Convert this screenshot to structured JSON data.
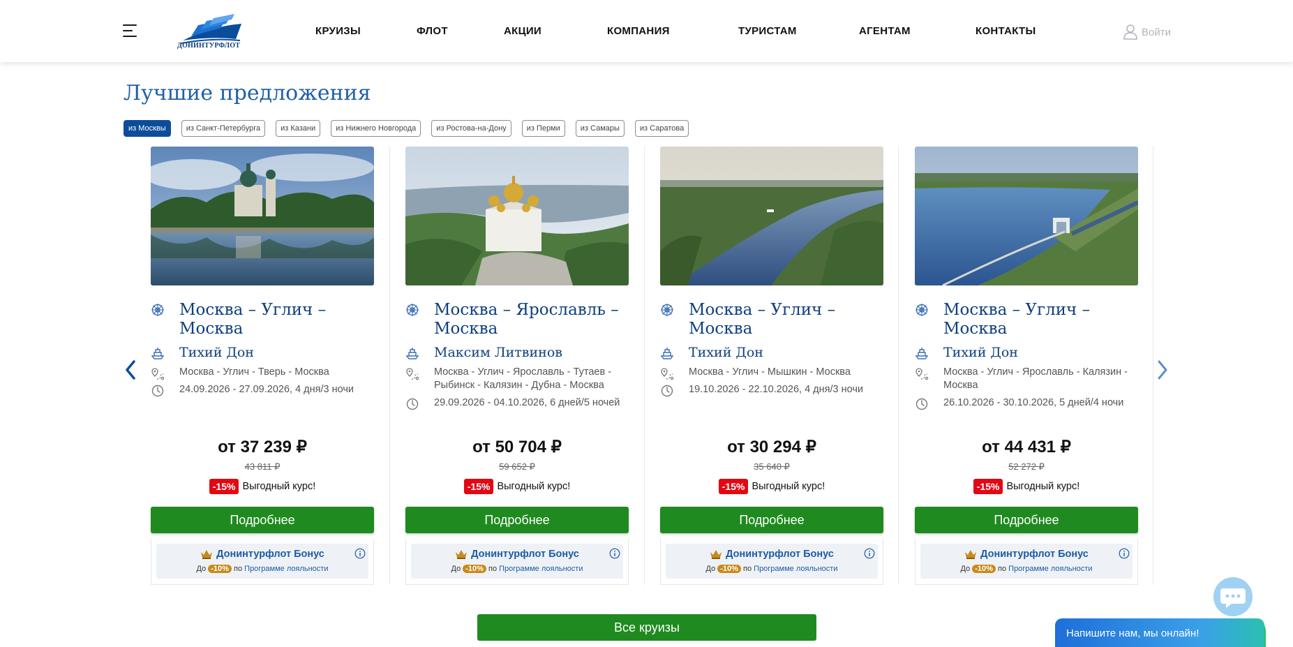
{
  "header": {
    "logo_text": "ДОНИНТУРФЛОТ",
    "nav": [
      "КРУИЗЫ",
      "ФЛОТ",
      "АКЦИИ",
      "КОМПАНИЯ",
      "ТУРИСТАМ",
      "АГЕНТАМ",
      "КОНТАКТЫ"
    ],
    "login_label": "Войти"
  },
  "section_title": "Лучшие предложения",
  "tabs": [
    "из Москвы",
    "из Санкт-Петербурга",
    "из Казани",
    "из Нижнего Новгорода",
    "из Ростова-на-Дону",
    "из Перми",
    "из Самары",
    "из Саратова"
  ],
  "active_tab": "из Москвы",
  "cards": [
    {
      "route": "Москва – Углич – Москва",
      "ship": "Тихий Дон",
      "stops": "Москва - Углич - Тверь - Москва",
      "dates": "24.09.2026 - 27.09.2026, 4 дня/3 ночи",
      "price": "от 37 239 ₽",
      "old_price": "43 811 ₽",
      "discount": "-15%",
      "promo": "Выгодный курс!",
      "button": "Подробнее",
      "bonus_title": "Донинтурфлот Бонус",
      "bonus_prefix": "До",
      "bonus_pct": "-10%",
      "bonus_mid": "по",
      "bonus_link": "Программе лояльности"
    },
    {
      "route": "Москва – Ярославль – Москва",
      "ship": "Максим Литвинов",
      "stops": "Москва - Углич - Ярославль - Тутаев - Рыбинск - Калязин - Дубна - Москва",
      "dates": "29.09.2026 - 04.10.2026, 6 дней/5 ночей",
      "price": "от 50 704 ₽",
      "old_price": "59 652 ₽",
      "discount": "-15%",
      "promo": "Выгодный курс!",
      "button": "Подробнее",
      "bonus_title": "Донинтурфлот Бонус",
      "bonus_prefix": "До",
      "bonus_pct": "-10%",
      "bonus_mid": "по",
      "bonus_link": "Программе лояльности"
    },
    {
      "route": "Москва – Углич – Москва",
      "ship": "Тихий Дон",
      "stops": "Москва - Углич - Мышкин - Москва",
      "dates": "19.10.2026 - 22.10.2026, 4 дня/3 ночи",
      "price": "от 30 294 ₽",
      "old_price": "35 640 ₽",
      "discount": "-15%",
      "promo": "Выгодный курс!",
      "button": "Подробнее",
      "bonus_title": "Донинтурфлот Бонус",
      "bonus_prefix": "До",
      "bonus_pct": "-10%",
      "bonus_mid": "по",
      "bonus_link": "Программе лояльности"
    },
    {
      "route": "Москва – Углич – Москва",
      "ship": "Тихий Дон",
      "stops": "Москва - Углич - Ярославль - Калязин - Москва",
      "dates": "26.10.2026 - 30.10.2026, 5 дней/4 ночи",
      "price": "от 44 431 ₽",
      "old_price": "52 272 ₽",
      "discount": "-15%",
      "promo": "Выгодный курс!",
      "button": "Подробнее",
      "bonus_title": "Донинтурфлот Бонус",
      "bonus_prefix": "До",
      "bonus_pct": "-10%",
      "bonus_mid": "по",
      "bonus_link": "Программе лояльности"
    }
  ],
  "all_cruises_button": "Все круизы",
  "chat_label": "Напишите нам, мы онлайн!",
  "colors": {
    "brand_blue": "#0b4d9a",
    "title_blue": "#1f5fa8",
    "button_green": "#1f8a1f",
    "discount_red": "#e30613"
  }
}
